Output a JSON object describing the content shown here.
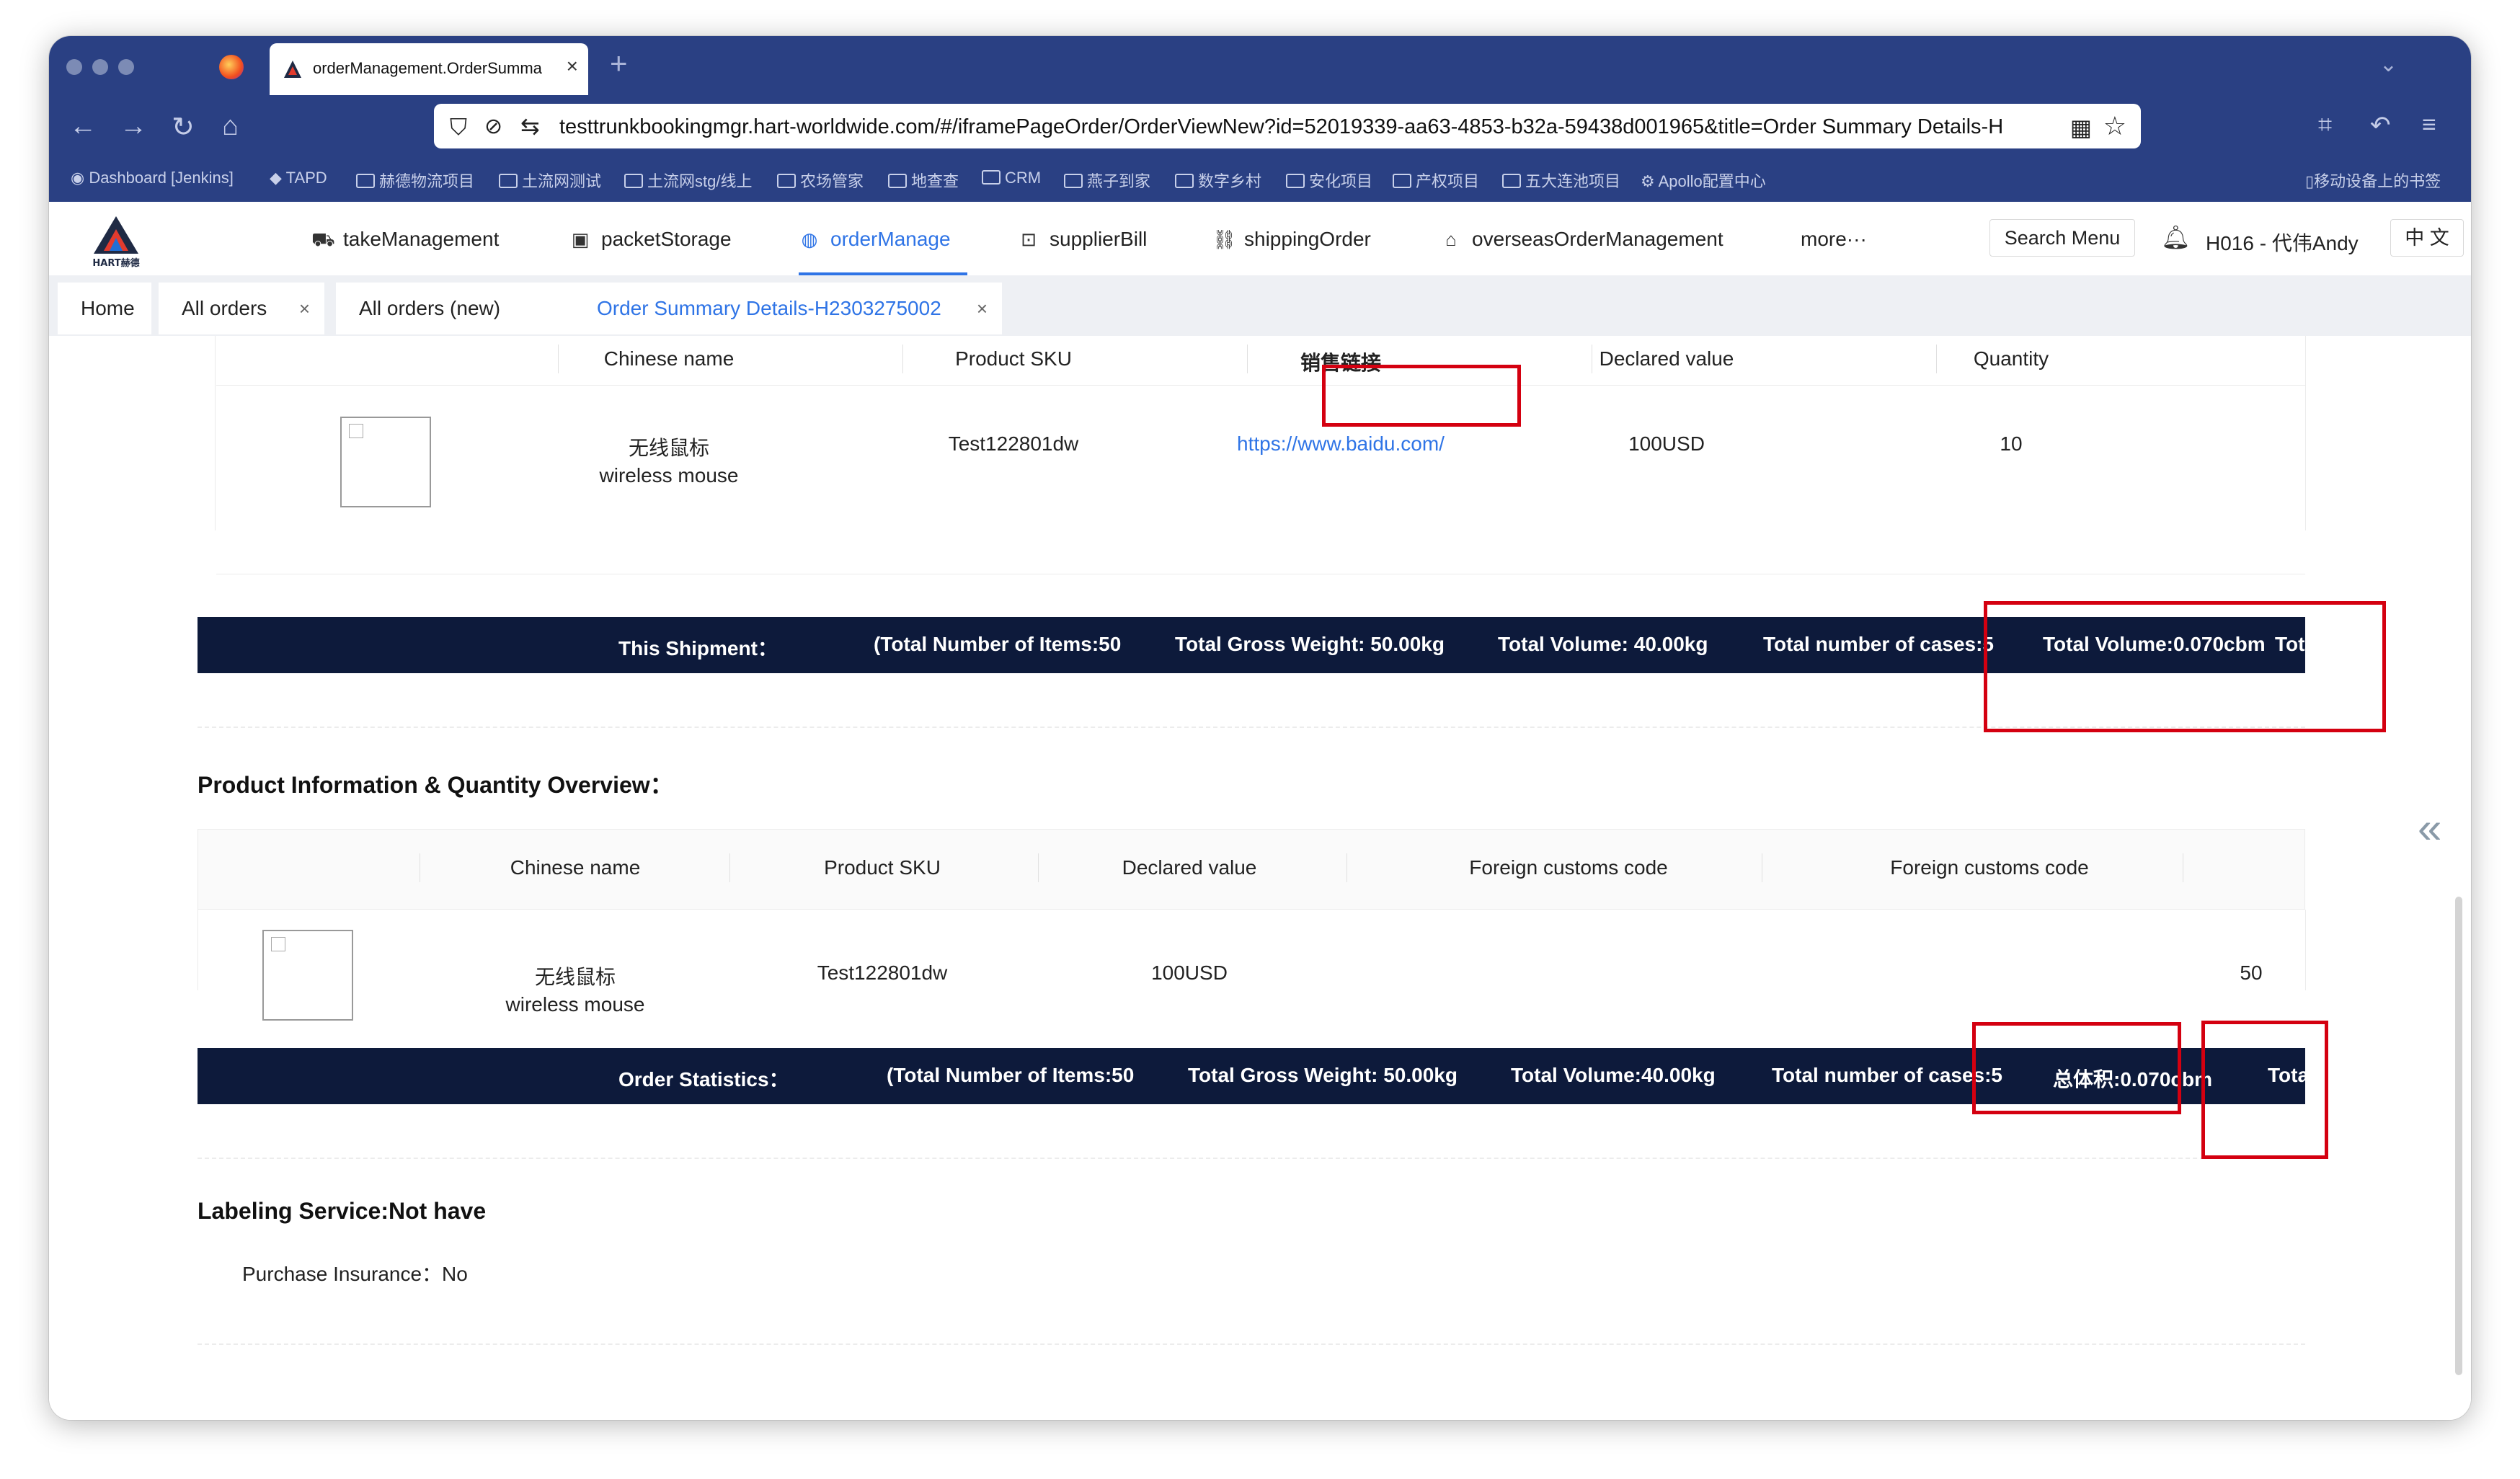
{
  "browser": {
    "active_tab_title": "orderManagement.OrderSumma",
    "url": "testtrunkbookingmgr.hart-worldwide.com/#/iframePageOrder/OrderViewNew?id=52019339-aa63-4853-b32a-59438d001965&title=Order Summary Details-H",
    "bookmarks": [
      "Dashboard [Jenkins]",
      "TAPD",
      "赫德物流项目",
      "土流网测试",
      "土流网stg/线上",
      "农场管家",
      "地查查",
      "CRM",
      "燕子到家",
      "数字乡村",
      "安化项目",
      "产权项目",
      "五大连池项目",
      "Apollo配置中心",
      "移动设备上的书签"
    ]
  },
  "header": {
    "logo_text": "HART赫德",
    "menu": [
      {
        "label": "takeManagement",
        "icon": "car-icon"
      },
      {
        "label": "packetStorage",
        "icon": "box-icon"
      },
      {
        "label": "orderManage",
        "icon": "globe-icon"
      },
      {
        "label": "supplierBill",
        "icon": "bill-icon"
      },
      {
        "label": "shippingOrder",
        "icon": "network-icon"
      },
      {
        "label": "overseasOrderManagement",
        "icon": "home-icon"
      },
      {
        "label": "more···",
        "icon": ""
      }
    ],
    "search_menu": "Search Menu",
    "user": "H016 - 代伟Andy",
    "language": "中 文"
  },
  "page_tabs": [
    {
      "label": "Home",
      "closable": false
    },
    {
      "label": "All orders",
      "closable": true
    },
    {
      "label": "All orders (new)",
      "closable": true
    },
    {
      "label": "Order Summary Details-H2303275002",
      "closable": true,
      "active": true
    }
  ],
  "shipment_table": {
    "headers": [
      "Chinese name",
      "Product SKU",
      "销售链接",
      "Declared value",
      "Quantity"
    ],
    "row": {
      "chinese_name": "无线鼠标",
      "english_name": "wireless mouse",
      "sku": "Test122801dw",
      "sales_link": "https://www.baidu.com/",
      "declared_value": "100USD",
      "quantity": "10"
    },
    "summary": {
      "label": "This Shipment：",
      "items": "(Total Number of Items:50",
      "gross_weight": "Total Gross Weight: 50.00kg",
      "volume": "Total Volume: 40.00kg",
      "cases": "Total number of cases:5",
      "total_volume_cbm": "Total Volume:0.070cbm",
      "truncated": "Tot"
    }
  },
  "overview": {
    "title": "Product Information & Quantity Overview：",
    "headers": [
      "Chinese name",
      "Product SKU",
      "Declared value",
      "Foreign customs code",
      "Foreign customs code"
    ],
    "row": {
      "chinese_name": "无线鼠标",
      "english_name": "wireless mouse",
      "sku": "Test122801dw",
      "declared_value": "100USD",
      "quantity": "50"
    },
    "stats": {
      "label": "Order Statistics：",
      "items": "(Total Number of Items:50",
      "gross_weight": "Total Gross Weight: 50.00kg",
      "volume": "Total Volume:40.00kg",
      "cases": "Total number of cases:5",
      "total_volume_cn": "总体积:0.070cbm",
      "truncated": "Total Val"
    }
  },
  "labeling": {
    "title": "Labeling Service:Not have",
    "insurance": "Purchase Insurance：No"
  },
  "colors": {
    "browser_chrome": "#2a4083",
    "accent": "#2f74e6",
    "dark_bar": "#0d1a3b",
    "annotation_red": "#d40010"
  }
}
